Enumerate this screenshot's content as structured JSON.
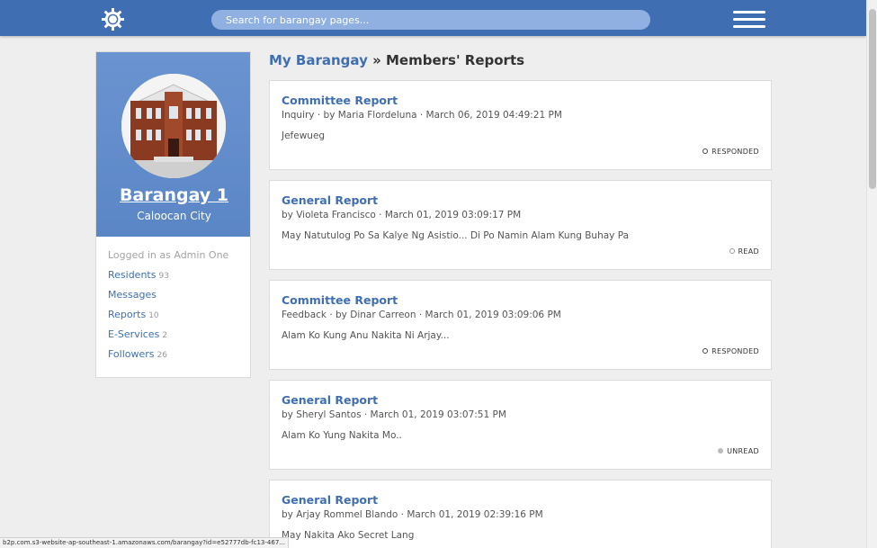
{
  "search": {
    "placeholder": "Search for barangay pages..."
  },
  "sidebar": {
    "name": "Barangay 1",
    "city": "Caloocan City",
    "logged_in": "Logged in as Admin One",
    "items": [
      {
        "label": "Residents",
        "count": "93"
      },
      {
        "label": "Messages",
        "count": ""
      },
      {
        "label": "Reports",
        "count": "10"
      },
      {
        "label": "E-Services",
        "count": "2"
      },
      {
        "label": "Followers",
        "count": "26"
      }
    ]
  },
  "heading": {
    "link": "My Barangay",
    "separator": " » ",
    "title": "Members' Reports"
  },
  "reports": [
    {
      "title": "Committee Report",
      "meta": "Inquiry · by Maria Flordeluna · March 06, 2019 04:49:21 PM",
      "body": "Jefewueg",
      "status": "RESPONDED"
    },
    {
      "title": "General Report",
      "meta": "by Violeta Francisco · March 01, 2019 03:09:17 PM",
      "body": "May Natutulog Po Sa Kalye Ng Asistio... Di Po Namin Alam Kung Buhay Pa",
      "status": "READ"
    },
    {
      "title": "Committee Report",
      "meta": "Feedback · by Dinar Carreon · March 01, 2019 03:09:06 PM",
      "body": "Alam Ko Kung Anu Nakita Ni Arjay...",
      "status": "RESPONDED"
    },
    {
      "title": "General Report",
      "meta": "by Sheryl Santos · March 01, 2019 03:07:51 PM",
      "body": "Alam Ko Yung Nakita Mo..",
      "status": "UNREAD"
    },
    {
      "title": "General Report",
      "meta": "by Arjay Rommel Blando · March 01, 2019 02:39:16 PM",
      "body": "May Nakita Ako Secret Lang",
      "status": ""
    }
  ],
  "statusbar": {
    "url": "b2p.com.s3-website-ap-southeast-1.amazonaws.com/barangay?id=e52777db-fc13-467..."
  },
  "colors": {
    "primary": "#3f6fb2",
    "header": "#3f6fb2",
    "background": "#eeeeee"
  }
}
